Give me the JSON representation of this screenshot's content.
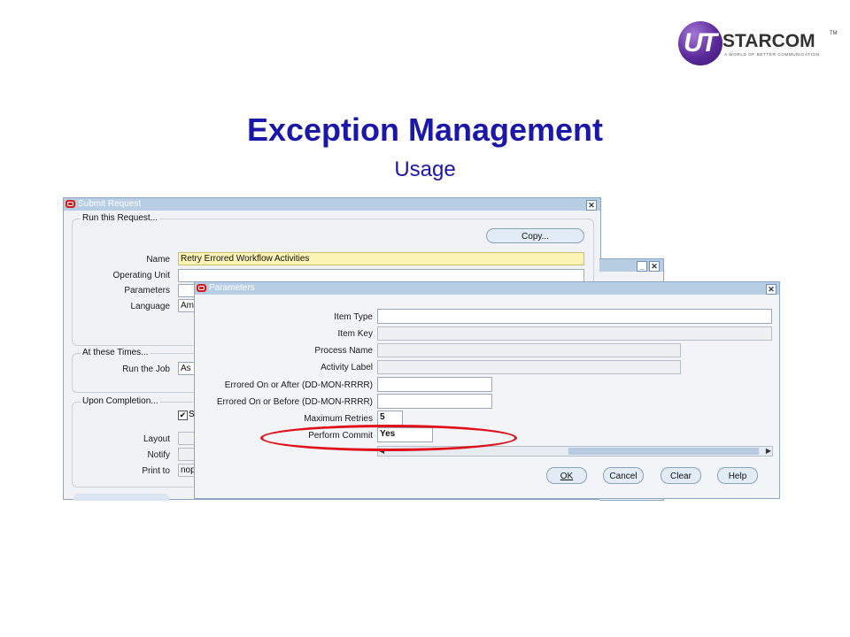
{
  "logo": {
    "mark_text": "UT",
    "name": "STARCOM",
    "tm": "TM",
    "tagline": "A WORLD OF BETTER COMMUNICATION"
  },
  "slide": {
    "title": "Exception Management",
    "subtitle": "Usage"
  },
  "submit_request": {
    "title": "Submit Request",
    "run_group": "Run this Request...",
    "copy_button": "Copy...",
    "labels": {
      "name": "Name",
      "operating_unit": "Operating Unit",
      "parameters": "Parameters",
      "language": "Language"
    },
    "values": {
      "name": "Retry Errored Workflow Activities",
      "operating_unit": "",
      "parameters": "",
      "language": "Am"
    },
    "times_group": "At these Times...",
    "run_the_job_label": "Run the Job",
    "run_the_job_value": "As",
    "completion_group": "Upon Completion...",
    "save_checkbox_label": "S",
    "layout_label": "Layout",
    "notify_label": "Notify",
    "print_to_label": "Print to",
    "print_to_value": "nop"
  },
  "middle_window": {
    "minimize": "_",
    "close": "✕"
  },
  "parameters": {
    "title": "Parameters",
    "close": "✕",
    "labels": {
      "item_type": "Item Type",
      "item_key": "Item Key",
      "process_name": "Process Name",
      "activity_label": "Activity Label",
      "errored_on_after": "Errored On or After (DD-MON-RRRR)",
      "errored_on_before": "Errored On or Before (DD-MON-RRRR)",
      "max_retries": "Maximum Retries",
      "perform_commit": "Perform Commit"
    },
    "values": {
      "item_type": "",
      "item_key": "",
      "process_name": "",
      "activity_label": "",
      "errored_on_after": "",
      "errored_on_before": "",
      "max_retries": "5",
      "perform_commit": "Yes"
    },
    "buttons": {
      "ok": "OK",
      "cancel": "Cancel",
      "clear": "Clear",
      "help": "Help"
    }
  },
  "colors": {
    "title_blue": "#1b17a8",
    "highlight_red": "#e0101a",
    "oracle_titlebar": "#b6cde3"
  }
}
